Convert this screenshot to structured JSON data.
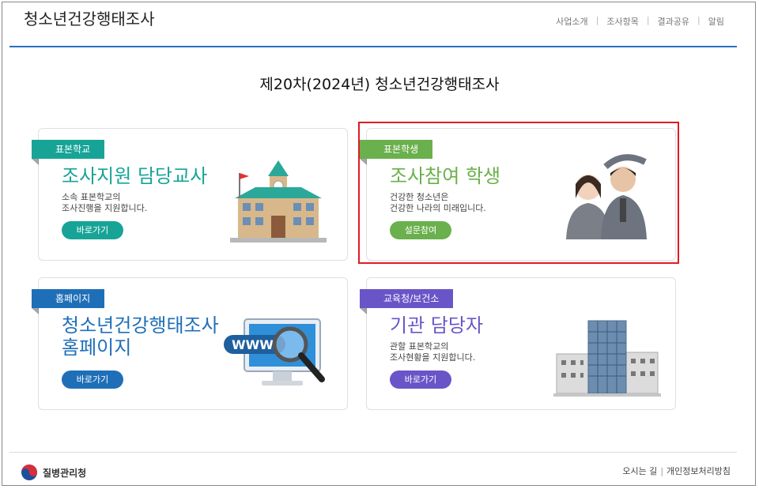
{
  "header": {
    "site_title": "청소년건강행태조사",
    "nav": [
      "사업소개",
      "조사항목",
      "결과공유",
      "알림"
    ]
  },
  "page_title": "제20차(2024년) 청소년건강행태조사",
  "cards": [
    {
      "tag": "표본학교",
      "title": "조사지원 담당교사",
      "desc": [
        "소속 표본학교의",
        "조사진행을 지원합니다."
      ],
      "button": "바로가기",
      "color": "#17a497",
      "image": "school-building-icon"
    },
    {
      "tag": "표본학생",
      "title": "조사참여 학생",
      "desc": [
        "건강한 청소년은",
        "건강한 나라의 미래입니다."
      ],
      "button": "설문참여",
      "color": "#6ab04c",
      "image": "students-photo"
    },
    {
      "tag": "홈페이지",
      "title": "청소년건강행태조사",
      "title2": "홈페이지",
      "desc": [],
      "button": "바로가기",
      "color": "#1f6fb8",
      "image": "www-magnifier-monitor-icon"
    },
    {
      "tag": "교육청/보건소",
      "title": "기관 담당자",
      "desc": [
        "관할 표본학교의",
        "조사현황을 지원합니다."
      ],
      "button": "바로가기",
      "color": "#6a55c8",
      "image": "office-buildings-icon"
    }
  ],
  "footer": {
    "logo_text": "질병관리청",
    "links": [
      "오시는 길",
      "개인정보처리방침"
    ]
  }
}
